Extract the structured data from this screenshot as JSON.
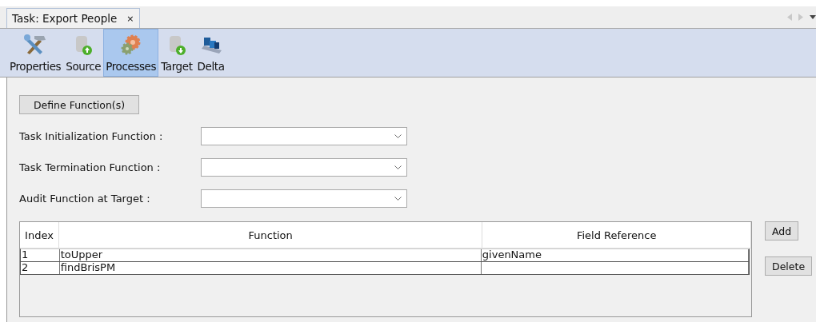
{
  "tab": {
    "title": "Task: Export People",
    "close": "×"
  },
  "toolbar": [
    {
      "label": "Properties",
      "selected": false
    },
    {
      "label": "Source",
      "selected": false
    },
    {
      "label": "Processes",
      "selected": true
    },
    {
      "label": "Target",
      "selected": false
    },
    {
      "label": "Delta",
      "selected": false
    }
  ],
  "define_button": "Define Function(s)",
  "fields": [
    {
      "label": "Task Initialization Function :"
    },
    {
      "label": "Task Termination Function :"
    },
    {
      "label": "Audit Function at Target :"
    }
  ],
  "table": {
    "columns": [
      "Index",
      "Function",
      "Field Reference"
    ],
    "rows": [
      [
        "1",
        "toUpper",
        "givenName"
      ],
      [
        "2",
        "findBrisPM",
        ""
      ]
    ]
  },
  "buttons": [
    "Add",
    "Delete"
  ]
}
